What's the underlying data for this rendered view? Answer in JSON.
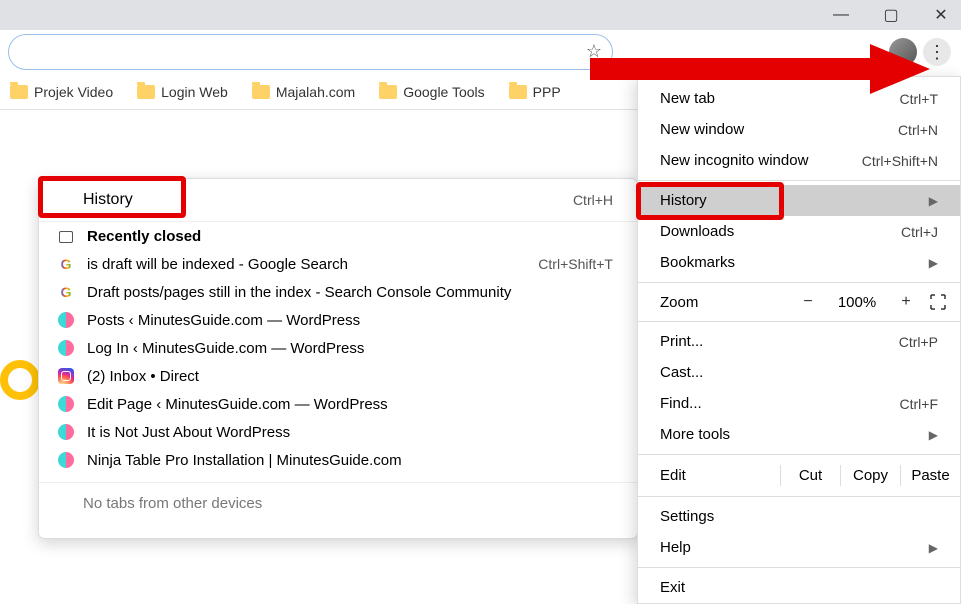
{
  "window": {
    "min": "—",
    "max": "▢",
    "close": "✕"
  },
  "bookmarks": [
    {
      "label": "Projek Video"
    },
    {
      "label": "Login Web"
    },
    {
      "label": "Majalah.com"
    },
    {
      "label": "Google Tools"
    },
    {
      "label": "PPP"
    }
  ],
  "submenu": {
    "headLabel": "History",
    "headSc": "Ctrl+H",
    "recent": "Recently closed",
    "reopenSc": "Ctrl+Shift+T",
    "items": [
      {
        "icon": "g",
        "txt": "is draft will be indexed - Google Search"
      },
      {
        "icon": "g",
        "txt": "Draft posts/pages still in the index - Search Console Community"
      },
      {
        "icon": "wp",
        "txt": "Posts ‹ MinutesGuide.com — WordPress"
      },
      {
        "icon": "wp",
        "txt": "Log In ‹ MinutesGuide.com — WordPress"
      },
      {
        "icon": "ig",
        "txt": "(2) Inbox • Direct"
      },
      {
        "icon": "wp",
        "txt": "Edit Page ‹ MinutesGuide.com — WordPress"
      },
      {
        "icon": "wp",
        "txt": "It is Not Just About WordPress"
      },
      {
        "icon": "wp",
        "txt": "Ninja Table Pro Installation | MinutesGuide.com"
      }
    ],
    "footer": "No tabs from other devices"
  },
  "menu": {
    "newTab": "New tab",
    "newTabSc": "Ctrl+T",
    "newWin": "New window",
    "newWinSc": "Ctrl+N",
    "incog": "New incognito window",
    "incogSc": "Ctrl+Shift+N",
    "history": "History",
    "downloads": "Downloads",
    "downloadsSc": "Ctrl+J",
    "bookmarks": "Bookmarks",
    "zoom": "Zoom",
    "zoomMinus": "−",
    "zoomVal": "100%",
    "zoomPlus": "+",
    "print": "Print...",
    "printSc": "Ctrl+P",
    "cast": "Cast...",
    "find": "Find...",
    "findSc": "Ctrl+F",
    "more": "More tools",
    "edit": "Edit",
    "cut": "Cut",
    "copy": "Copy",
    "paste": "Paste",
    "settings": "Settings",
    "help": "Help",
    "exit": "Exit"
  }
}
